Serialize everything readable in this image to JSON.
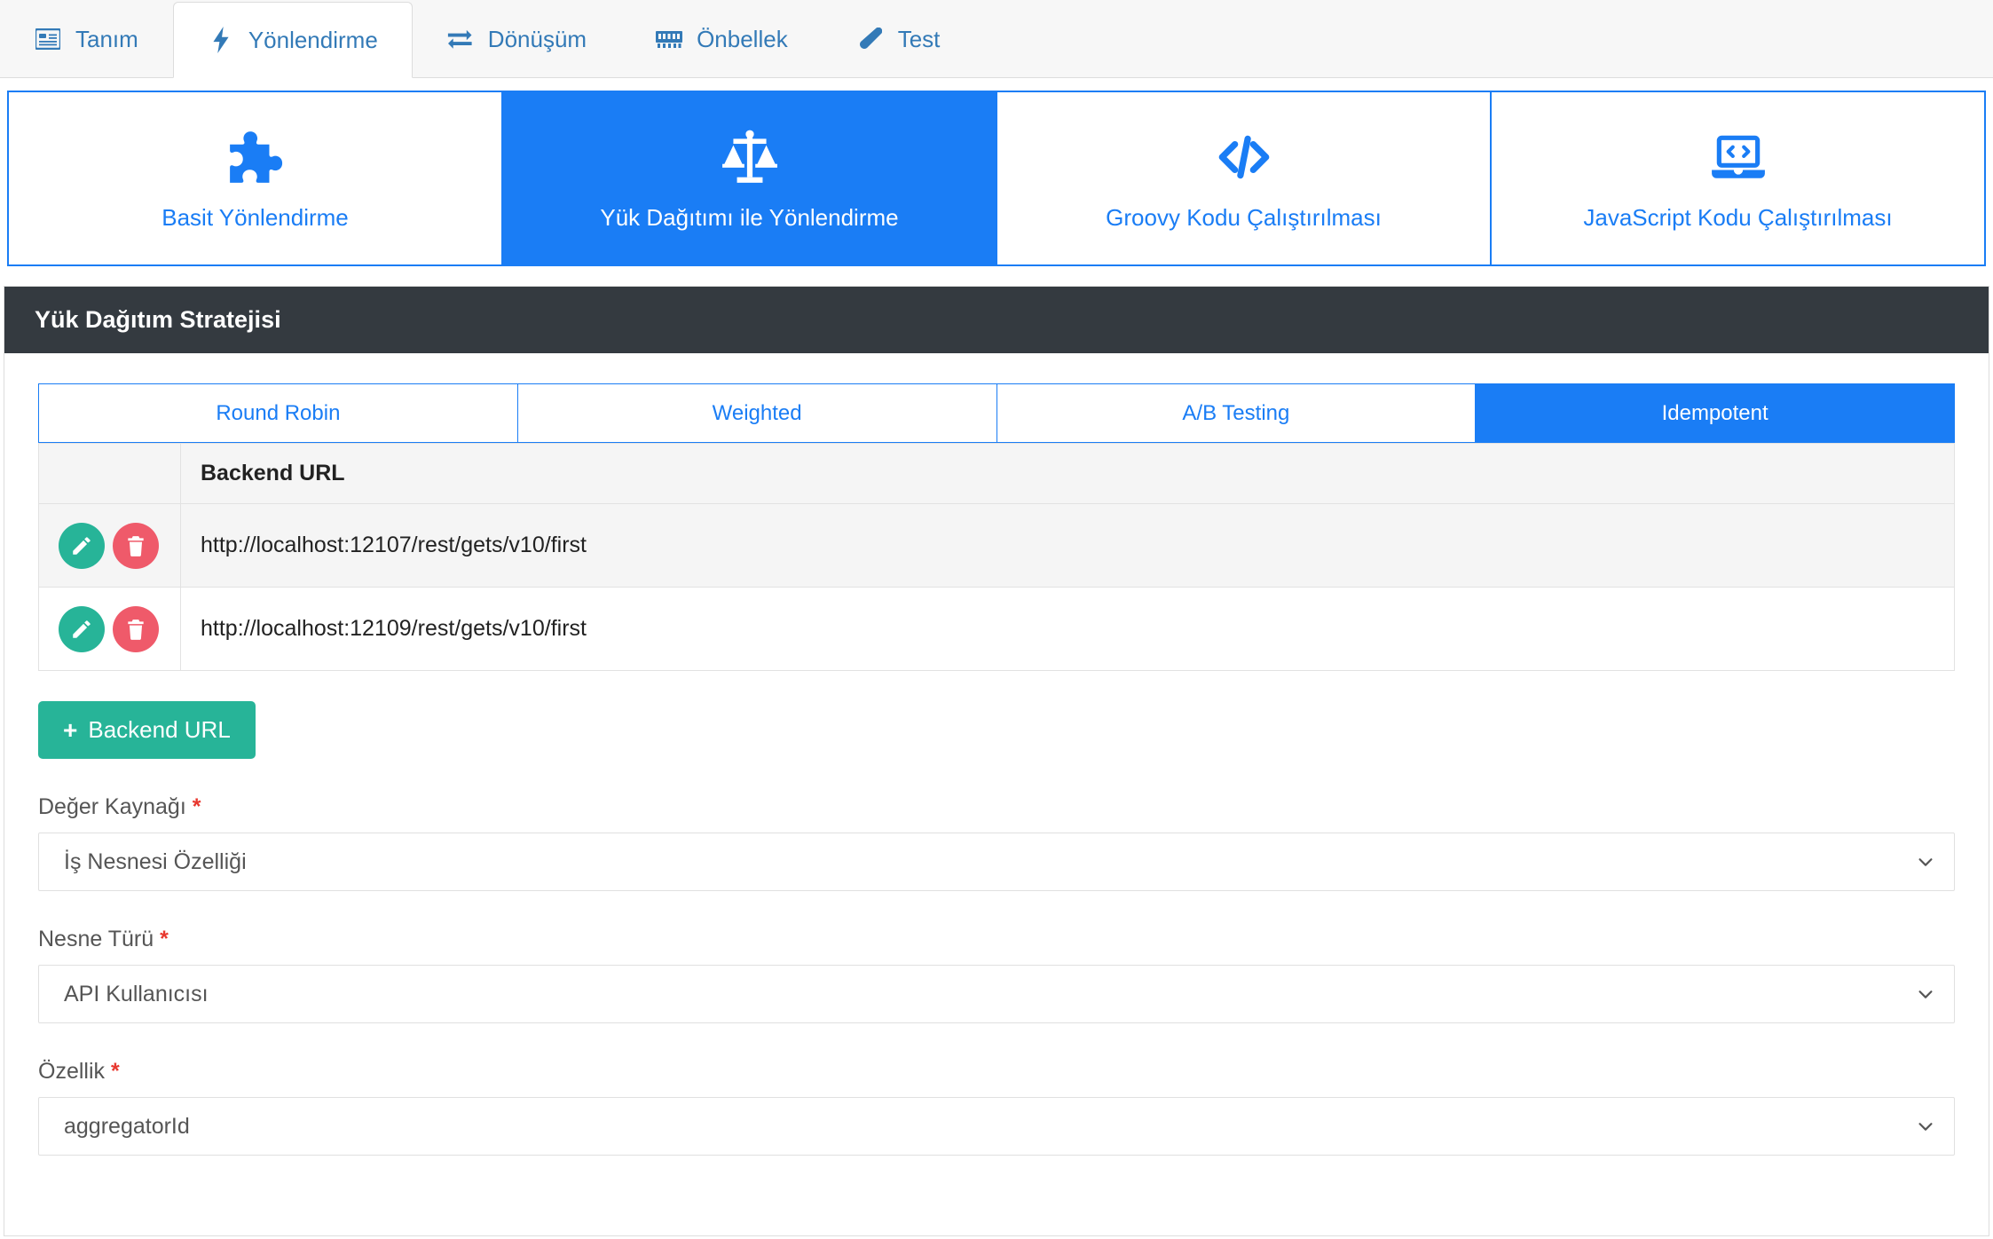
{
  "topnav": {
    "tabs": [
      {
        "label": "Tanım",
        "icon": "table-list-icon",
        "active": false
      },
      {
        "label": "Yönlendirme",
        "icon": "bolt-icon",
        "active": true
      },
      {
        "label": "Dönüşüm",
        "icon": "exchange-arrows-icon",
        "active": false
      },
      {
        "label": "Önbellek",
        "icon": "memory-chip-icon",
        "active": false
      },
      {
        "label": "Test",
        "icon": "test-tube-icon",
        "active": false
      }
    ]
  },
  "cardtabs": [
    {
      "label": "Basit Yönlendirme",
      "icon": "puzzle-piece-icon",
      "active": false
    },
    {
      "label": "Yük Dağıtımı ile Yönlendirme",
      "icon": "balance-scale-icon",
      "active": true
    },
    {
      "label": "Groovy Kodu Çalıştırılması",
      "icon": "code-brackets-icon",
      "active": false
    },
    {
      "label": "JavaScript Kodu Çalıştırılması",
      "icon": "laptop-code-icon",
      "active": false
    }
  ],
  "panel": {
    "title": "Yük Dağıtım Stratejisi",
    "strategy_tabs": [
      {
        "label": "Round Robin",
        "active": false
      },
      {
        "label": "Weighted",
        "active": false
      },
      {
        "label": "A/B Testing",
        "active": false
      },
      {
        "label": "Idempotent",
        "active": true
      }
    ],
    "table": {
      "headers": {
        "actions": "",
        "url": "Backend URL"
      },
      "rows": [
        {
          "url": "http://localhost:12107/rest/gets/v10/first"
        },
        {
          "url": "http://localhost:12109/rest/gets/v10/first"
        }
      ]
    },
    "add_button": {
      "plus": "+",
      "label": "Backend URL"
    },
    "fields": [
      {
        "label": "Değer Kaynağı",
        "required": "*",
        "value": "İş Nesnesi Özelliği"
      },
      {
        "label": "Nesne Türü",
        "required": "*",
        "value": "API Kullanıcısı"
      },
      {
        "label": "Özellik",
        "required": "*",
        "value": "aggregatorId"
      }
    ]
  },
  "colors": {
    "accent_blue": "#1a7df5",
    "link_blue": "#337ab7",
    "panel_dark": "#343a40",
    "green": "#27b498",
    "red": "#ef5a6a",
    "required_red": "#e8382f"
  }
}
